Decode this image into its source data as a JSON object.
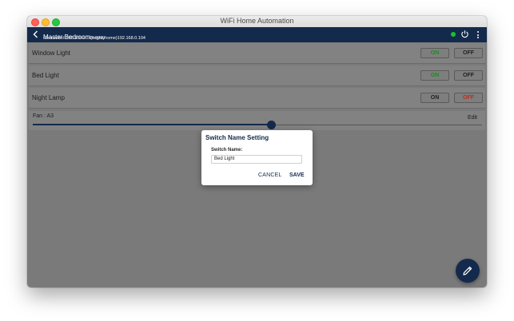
{
  "window": {
    "title": "WiFi Home Automation"
  },
  "header": {
    "room_name": "Master Bedroom",
    "host_info": "(mightyhome)192.168.0.104",
    "connection": "Connected 192.168.0.108:8080",
    "status_color": "#19c12f"
  },
  "switches": [
    {
      "label": "Window Light",
      "on_label": "ON",
      "off_label": "OFF",
      "state": "on"
    },
    {
      "label": "Bed Light",
      "on_label": "ON",
      "off_label": "OFF",
      "state": "on"
    },
    {
      "label": "Night Lamp",
      "on_label": "ON",
      "off_label": "OFF",
      "state": "off"
    }
  ],
  "fan": {
    "label": "Fan : A3",
    "edit_label": "Edit",
    "level_fraction": 0.53
  },
  "dialog": {
    "title": "Switch Name Setting",
    "field_label": "Switch Name:",
    "field_value": "Bed Light",
    "cancel_label": "CANCEL",
    "save_label": "SAVE"
  },
  "fab": {
    "icon": "pencil-icon"
  },
  "colors": {
    "accent": "#142a4c",
    "on_active": "#1f8a24",
    "off_active": "#c62a18"
  }
}
